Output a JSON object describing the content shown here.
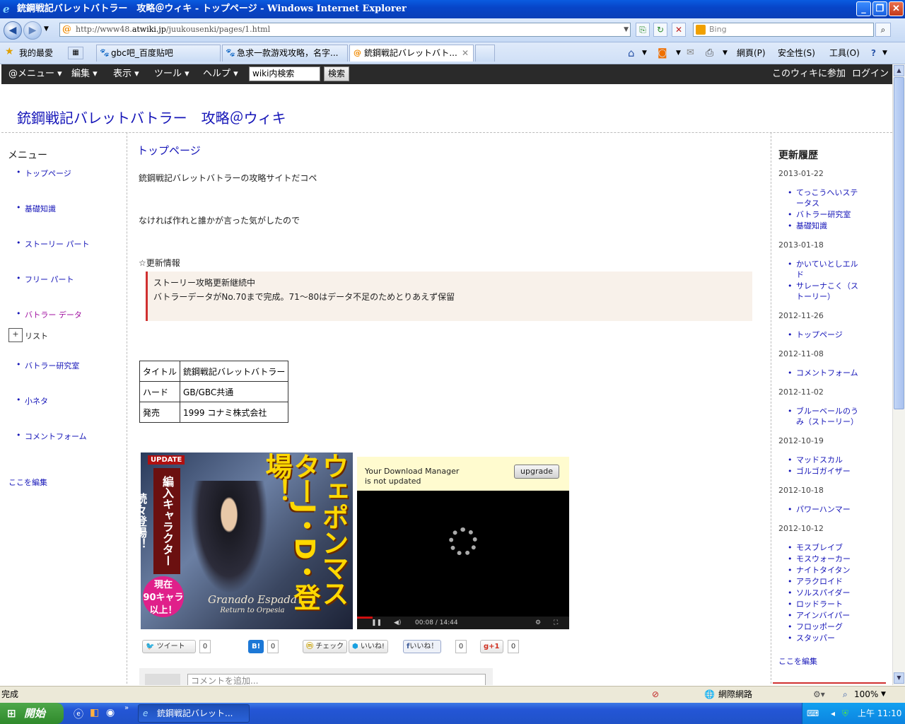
{
  "window": {
    "title": "銃鋼戦記バレットバトラー　攻略＠ウィキ - トップページ - Windows Internet Explorer"
  },
  "address": {
    "url_prefix": "http://www48.",
    "url_domain": "atwiki.jp",
    "url_path": "/juukousenki/pages/1.html",
    "search_placeholder": "Bing"
  },
  "favorites": {
    "label": "我的最愛"
  },
  "tabs": [
    {
      "label": "gbc吧_百度贴吧"
    },
    {
      "label": "急求一款游戏攻略，名字..."
    },
    {
      "label": "銃鋼戦記バレットバト..."
    }
  ],
  "commandbar": {
    "page": "網頁(P)",
    "safety": "安全性(S)",
    "tools": "工具(O)"
  },
  "wikibar": {
    "menus": [
      "@メニュー",
      "編集",
      "表示",
      "ツール",
      "ヘルプ"
    ],
    "search_value": "wiki内検索",
    "search_button": "検索",
    "join": "このウィキに参加",
    "login": "ログイン"
  },
  "site": {
    "title": "銃鋼戦記バレットバトラー　攻略＠ウィキ"
  },
  "left": {
    "heading": "メニュー",
    "items": [
      "トップページ",
      "基礎知識",
      "ストーリー パート",
      "フリー パート",
      "バトラー データ",
      "リスト",
      "バトラー研究室",
      "小ネタ",
      "コメントフォーム"
    ],
    "edit": "ここを編集"
  },
  "main": {
    "title": "トップページ",
    "line1": "銃鋼戦記バレットバトラーの攻略サイトだコペ",
    "line2": "なければ作れと誰かが言った気がしたので",
    "news_heading": "☆更新情報",
    "notice1": "ストーリー攻略更新継続中",
    "notice2": "バトラーデータがNo.70まで完成。71～80はデータ不足のためとりあえず保留",
    "table": [
      {
        "k": "タイトル",
        "v": "銃鋼戦記バレットバトラー"
      },
      {
        "k": "ハード",
        "v": "GB/GBC共通"
      },
      {
        "k": "発売",
        "v": "1999 コナミ株式会社"
      }
    ],
    "ad": {
      "update": "UPDATE",
      "vertical1": "ウェポンマスターJ・D・登場！",
      "vertical2": "編入キャラクター続々登場！",
      "now1": "現在",
      "now2": "90キャラ",
      "now3": "以上！",
      "logo1": "Granado Espada",
      "logo2": "Return to Orpesia"
    },
    "video": {
      "msg1": "Your Download Manager",
      "msg2": "is not updated",
      "upgrade": "upgrade",
      "time": "00:08 / 14:44",
      "progress": 0.01
    },
    "share": {
      "tweet": "ツイート",
      "tweet_count": "0",
      "hatena": "B!",
      "hatena_count": "0",
      "check": "チェック",
      "iine": "いいね!",
      "fb": "いいね！",
      "fb_count": "0",
      "gplus": "+1",
      "gplus_count": "0"
    },
    "comment_placeholder": "コメントを追加..."
  },
  "right": {
    "heading": "更新履歴",
    "groups": [
      {
        "date": "2013-01-22",
        "items": [
          "てっこうへいステータス",
          "バトラー研究室",
          "基礎知識"
        ]
      },
      {
        "date": "2013-01-18",
        "items": [
          "かいていとしエルド",
          "サレーナこく（ストーリー）"
        ]
      },
      {
        "date": "2012-11-26",
        "items": [
          "トップページ"
        ]
      },
      {
        "date": "2012-11-08",
        "items": [
          "コメントフォーム"
        ]
      },
      {
        "date": "2012-11-02",
        "items": [
          "ブルーベールのうみ（ストーリー）"
        ]
      },
      {
        "date": "2012-10-19",
        "items": [
          "マッドスカル",
          "ゴルゴガイザー"
        ]
      },
      {
        "date": "2012-10-18",
        "items": [
          "パワーハンマー"
        ]
      },
      {
        "date": "2012-10-12",
        "items": [
          "モスブレイブ",
          "モスウォーカー",
          "ナイトタイタン",
          "アラクロイド",
          "ソルスパイダー",
          "ロッドラート",
          "アインバイパー",
          "フロッポーグ",
          "スタッパー"
        ]
      }
    ],
    "edit": "ここを編集"
  },
  "status": {
    "text": "完成",
    "zone": "網際網路",
    "zoom": "100%"
  },
  "taskbar": {
    "start": "開始",
    "item": "銃鋼戦記バレット...",
    "clock": "上午 11:10"
  }
}
